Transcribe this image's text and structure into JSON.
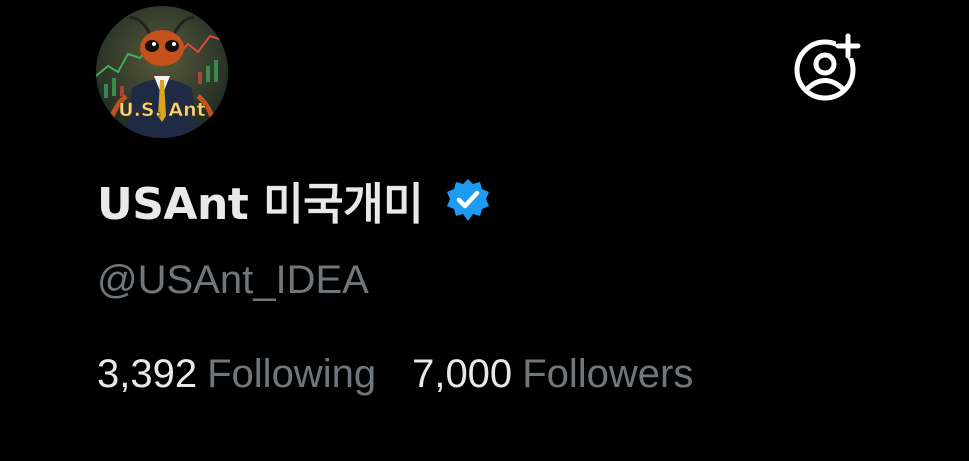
{
  "profile": {
    "display_name": "USAnt 미국개미",
    "handle": "@USAnt_IDEA",
    "verified": true,
    "avatar": {
      "text": "U.S. Ant",
      "icon": "ant-in-suit-avatar"
    }
  },
  "follow_button": {
    "icon": "add-person-icon"
  },
  "stats": {
    "following_count": "3,392",
    "following_label": "Following",
    "followers_count": "7,000",
    "followers_label": "Followers"
  },
  "colors": {
    "background": "#000000",
    "primary_text": "#e7e9ea",
    "secondary_text": "#71767b",
    "verified_blue": "#1d9bf0"
  }
}
